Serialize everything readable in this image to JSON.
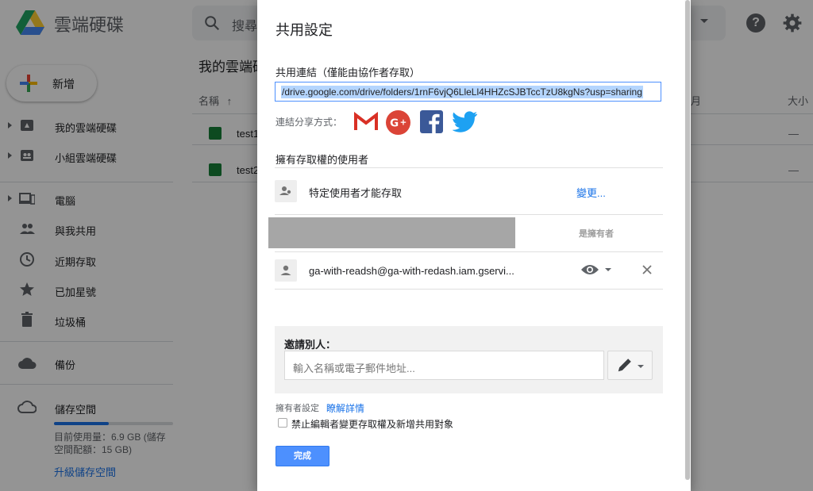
{
  "app": {
    "title": "雲端硬碟"
  },
  "search": {
    "placeholder": "搜尋"
  },
  "sidebar": {
    "new_label": "新增",
    "items": [
      {
        "label": "我的雲端硬碟",
        "icon": "drive-icon"
      },
      {
        "label": "小組雲端硬碟",
        "icon": "team-drive-icon"
      },
      {
        "label": "電腦",
        "icon": "computer-icon"
      },
      {
        "label": "與我共用",
        "icon": "shared-people-icon"
      },
      {
        "label": "近期存取",
        "icon": "clock-icon"
      },
      {
        "label": "已加星號",
        "icon": "star-icon"
      },
      {
        "label": "垃圾桶",
        "icon": "trash-icon"
      },
      {
        "label": "備份",
        "icon": "cloud-icon"
      },
      {
        "label": "儲存空間",
        "icon": "cloud-outline-icon"
      }
    ],
    "storage": {
      "used_text": "目前使用量：6.9 GB (儲存空間配額：15 GB)",
      "used_fraction": 0.46,
      "upgrade_label": "升級儲存空間"
    }
  },
  "main": {
    "breadcrumb": "我的雲端硬",
    "columns": {
      "name": "名稱",
      "sort_icon": "arrow-up-icon",
      "modified_fragment": "月",
      "size": "大小"
    },
    "files": [
      {
        "name": "test1",
        "size": "—"
      },
      {
        "name": "test2",
        "size": "—"
      }
    ]
  },
  "dialog": {
    "title": "共用設定",
    "link_section_label": "共用連結（僅能由協作者存取）",
    "link_value": "/drive.google.com/drive/folders/1rnF6vjQ6LleLl4HHZcSJBTccTzU8kgNs?usp=sharing",
    "share_via_label": "連結分享方式：",
    "share_services": [
      "gmail-icon",
      "google-plus-icon",
      "facebook-icon",
      "twitter-icon"
    ],
    "access_section_label": "擁有存取權的使用者",
    "access_level_text": "特定使用者才能存取",
    "change_link": "變更...",
    "owner_label": "是擁有者",
    "user_email": "ga-with-readsh@ga-with-redash.iam.gservi...",
    "invite_label": "邀請別人：",
    "invite_placeholder": "輸入名稱或電子郵件地址...",
    "owner_settings_label": "擁有者設定",
    "learn_more": "瞭解詳情",
    "checkbox_label": "禁止編輯者變更存取權及新增共用對象",
    "checkbox_checked": false,
    "done_label": "完成"
  },
  "colors": {
    "accent": "#4d90fe",
    "link": "#1a73e8",
    "overlay": "#000000"
  }
}
